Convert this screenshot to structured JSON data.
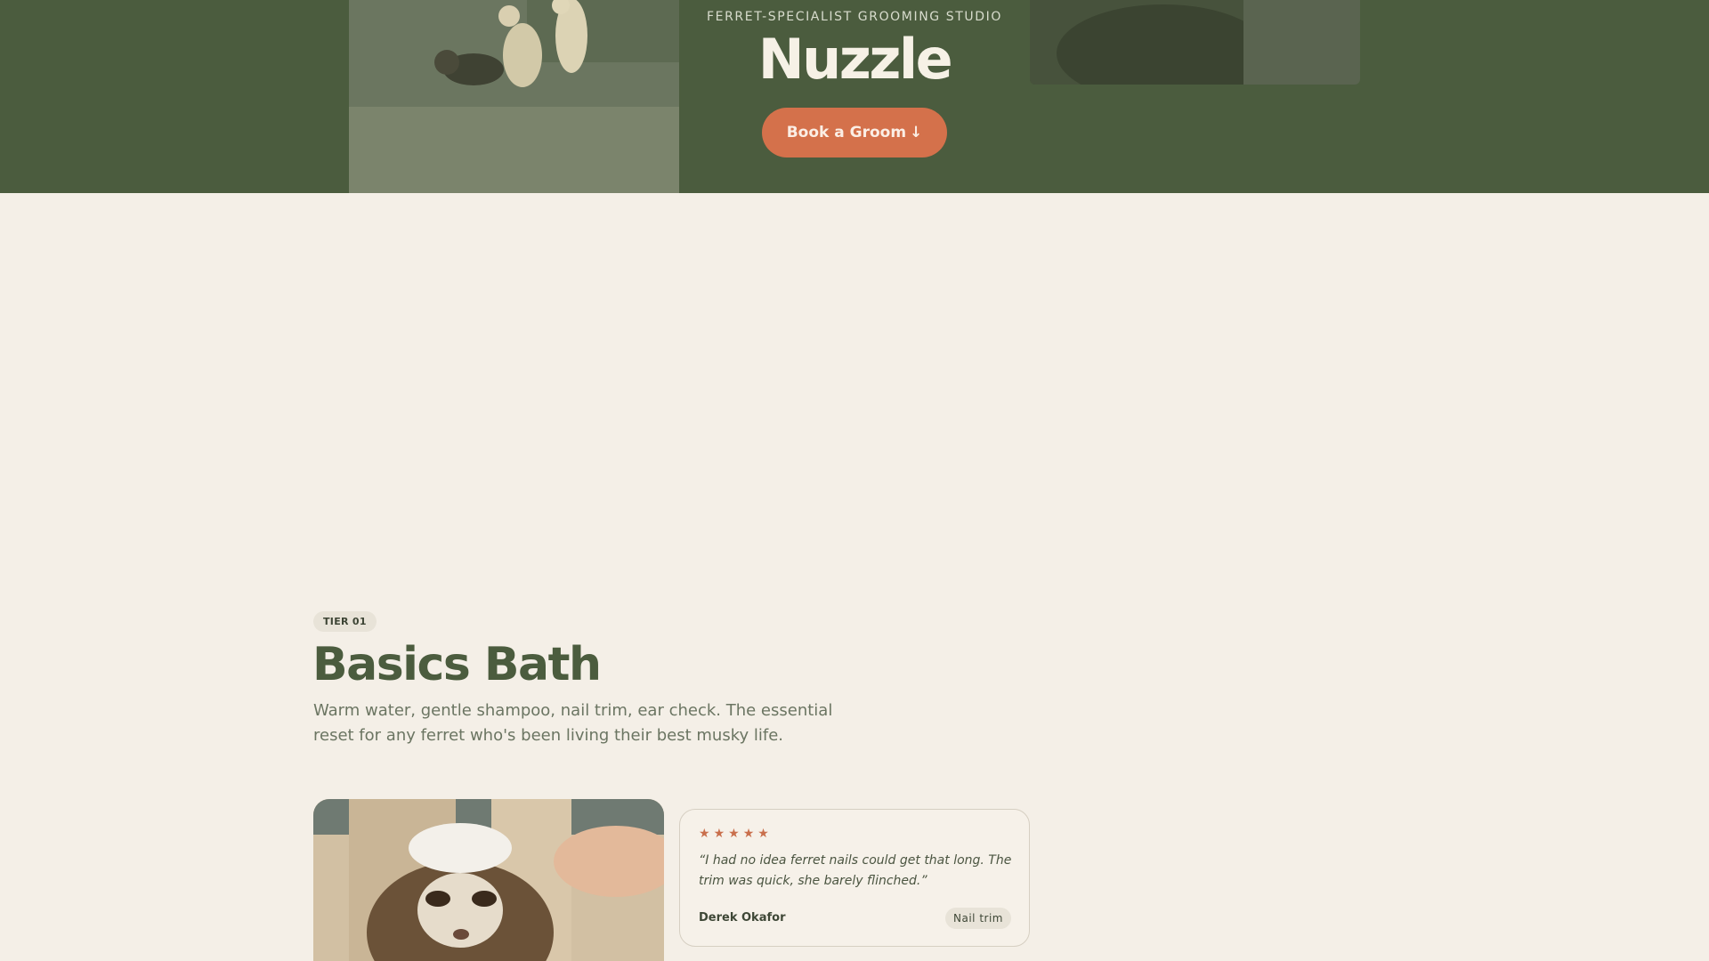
{
  "hero": {
    "kicker": "FERRET-SPECIALIST GROOMING STUDIO",
    "title": "Nuzzle",
    "cta_label": "Book a Groom",
    "cta_icon": "arrow-down-icon",
    "accent_color": "#d4714b",
    "background_color": "#4b5c3e"
  },
  "tier": {
    "badge": "TIER 01",
    "title": "Basics Bath",
    "description": "Warm water, gentle shampoo, nail trim, ear check. The essential reset for any ferret who's been living their best musky life."
  },
  "review": {
    "rating": 5,
    "stars_display": "★★★★★",
    "quote": "“I had no idea ferret nails could get that long. The trim was quick, she barely flinched.”",
    "author": "Derek Okafor",
    "service": "Nail trim"
  }
}
